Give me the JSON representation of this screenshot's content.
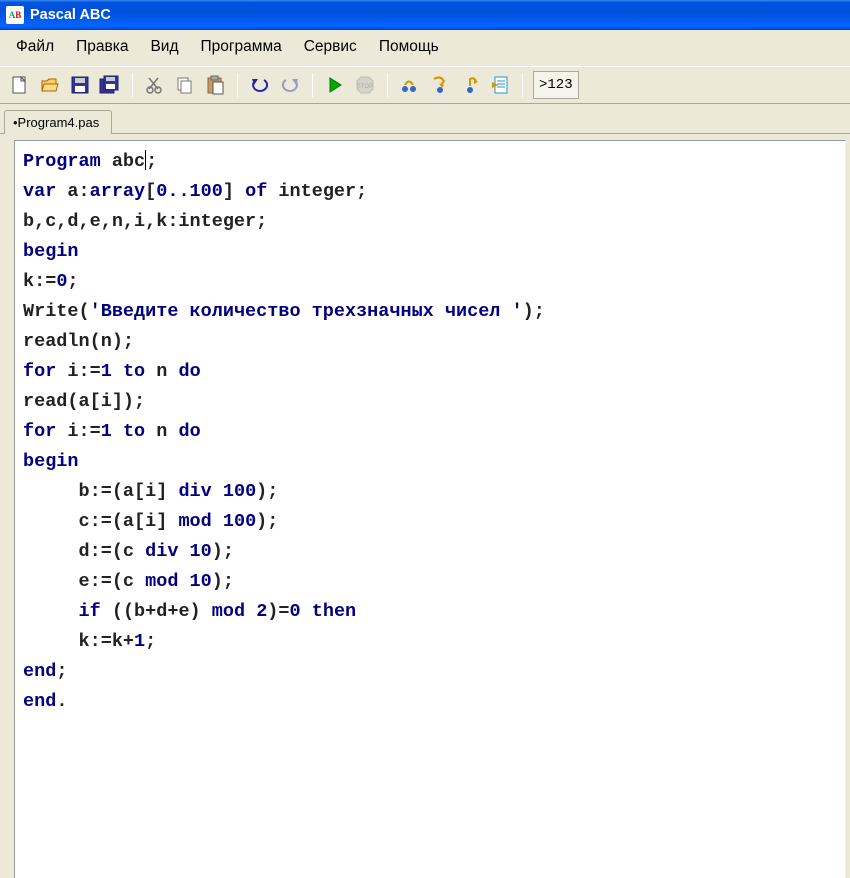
{
  "title": "Pascal ABC",
  "menu": {
    "file": "Файл",
    "edit": "Правка",
    "view": "Вид",
    "program": "Программа",
    "service": "Сервис",
    "help": "Помощь"
  },
  "toolbar": {
    "num_btn": ">123"
  },
  "tab": {
    "label": "•Program4.pas"
  },
  "code": {
    "l1a": "Program",
    "l1b": " abc",
    "l1c": ";",
    "l2a": "var",
    "l2b": " a:",
    "l2c": "array",
    "l2d": "[",
    "l2e": "0..100",
    "l2f": "] ",
    "l2g": "of",
    "l2h": " integer;",
    "l3": "b,c,d,e,n,i,k:integer;",
    "l4": "begin",
    "l5a": "k:=",
    "l5b": "0",
    "l5c": ";",
    "l6a": "Write(",
    "l6b": "'Введите количество трехзначных чисел '",
    "l6c": ");",
    "l7": "readln(n);",
    "l8a": "for",
    "l8b": " i:=",
    "l8c": "1",
    "l8d": " ",
    "l8e": "to",
    "l8f": " n ",
    "l8g": "do",
    "l9": "read(a[i]);",
    "l10a": "for",
    "l10b": " i:=",
    "l10c": "1",
    "l10d": " ",
    "l10e": "to",
    "l10f": " n ",
    "l10g": "do",
    "l11": "begin",
    "l12a": "     b:=(a[i] ",
    "l12b": "div",
    "l12c": " ",
    "l12d": "100",
    "l12e": ");",
    "l13a": "     c:=(a[i] ",
    "l13b": "mod",
    "l13c": " ",
    "l13d": "100",
    "l13e": ");",
    "l14a": "     d:=(c ",
    "l14b": "div",
    "l14c": " ",
    "l14d": "10",
    "l14e": ");",
    "l15a": "     e:=(c ",
    "l15b": "mod",
    "l15c": " ",
    "l15d": "10",
    "l15e": ");",
    "l16a": "     ",
    "l16b": "if",
    "l16c": " ((b+d+e) ",
    "l16d": "mod",
    "l16e": " ",
    "l16f": "2",
    "l16g": ")=",
    "l16h": "0",
    "l16i": " ",
    "l16j": "then",
    "l17a": "     k:=k+",
    "l17b": "1",
    "l17c": ";",
    "l18a": "end",
    "l18b": ";",
    "l19a": "end",
    "l19b": "."
  }
}
